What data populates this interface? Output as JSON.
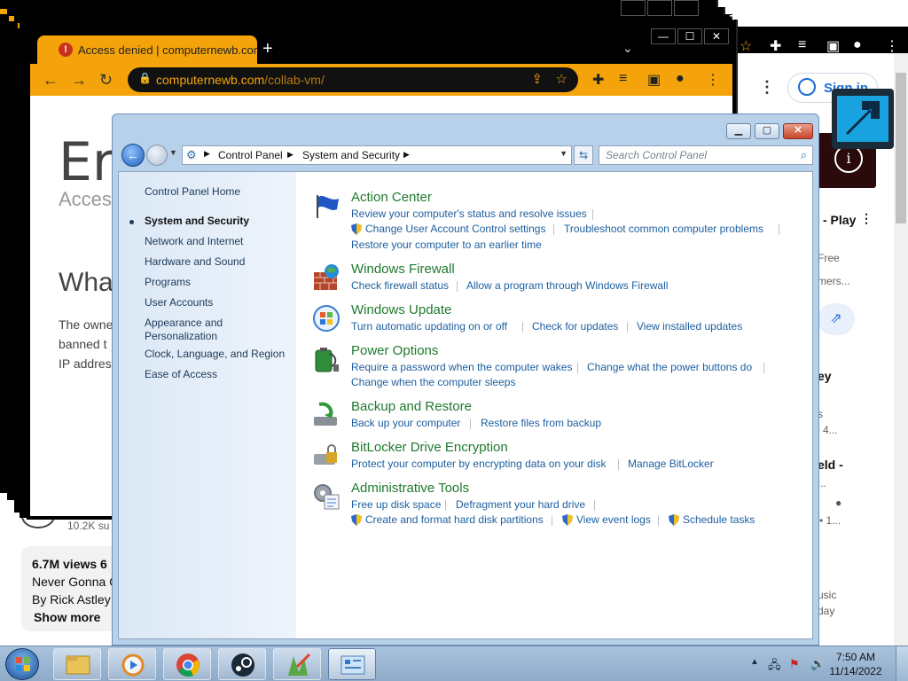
{
  "browser": {
    "tab_title": "Access denied | computernewb.com",
    "tab_close_icon": "close-icon",
    "new_tab_icon": "plus-icon",
    "address": {
      "host": "computernewb.com",
      "path": "/collab-vm/"
    },
    "window_controls": [
      "–",
      "☐",
      "✕"
    ]
  },
  "error_page": {
    "title": "Err",
    "subtitle": "Acces",
    "heading": "Wha",
    "lines": [
      "The owne",
      "banned t",
      "IP addres"
    ]
  },
  "youtube_background": {
    "sign_in": "Sign in",
    "play_text": "- Play",
    "free_text": "Free",
    "mers_text": "mers...",
    "ey_text": "ey",
    "s_text": "s",
    "num4_text": "4...",
    "eld_text": "eld -",
    "dots_text": "...",
    "one_text": "• 1...",
    "usic_text": "usic",
    "day_text": "day",
    "subscribers": "10.2K su",
    "views": "6.7M views  6",
    "desc_line1": "Never Gonna G",
    "desc_line2": "By Rick Astley",
    "show_more": "Show more"
  },
  "control_panel": {
    "window_buttons": [
      "▁",
      "▢",
      "✕"
    ],
    "breadcrumb": [
      "Control Panel",
      "System and Security"
    ],
    "search_placeholder": "Search Control Panel",
    "left_nav": [
      {
        "label": "Control Panel Home"
      },
      {
        "label": "System and Security"
      },
      {
        "label": "Network and Internet"
      },
      {
        "label": "Hardware and Sound"
      },
      {
        "label": "Programs"
      },
      {
        "label": "User Accounts"
      },
      {
        "label": "Appearance and"
      },
      {
        "label": "Personalization"
      },
      {
        "label": "Clock, Language, and Region"
      },
      {
        "label": "Ease of Access"
      }
    ],
    "sections": [
      {
        "title": "Action Center",
        "icon": "flag-icon",
        "links": [
          "Review your computer's status and resolve issues",
          "Change User Account Control settings",
          "Troubleshoot common computer problems",
          "Restore your computer to an earlier time"
        ]
      },
      {
        "title": "Windows Firewall",
        "icon": "firewall-icon",
        "links": [
          "Check firewall status",
          "Allow a program through Windows Firewall"
        ]
      },
      {
        "title": "Windows Update",
        "icon": "update-icon",
        "links": [
          "Turn automatic updating on or off",
          "Check for updates",
          "View installed updates"
        ]
      },
      {
        "title": "Power Options",
        "icon": "battery-icon",
        "links": [
          "Require a password when the computer wakes",
          "Change what the power buttons do",
          "Change when the computer sleeps"
        ]
      },
      {
        "title": "Backup and Restore",
        "icon": "backup-icon",
        "links": [
          "Back up your computer",
          "Restore files from backup"
        ]
      },
      {
        "title": "BitLocker Drive Encryption",
        "icon": "bitlocker-icon",
        "links": [
          "Protect your computer by encrypting data on your disk",
          "Manage BitLocker"
        ]
      },
      {
        "title": "Administrative Tools",
        "icon": "admin-tools-icon",
        "links": [
          "Free up disk space",
          "Defragment your hard drive",
          "Create and format hard disk partitions",
          "View event logs",
          "Schedule tasks"
        ]
      }
    ]
  },
  "taskbar": {
    "apps": [
      "explorer-icon",
      "media-player-icon",
      "chrome-icon",
      "steam-icon",
      "paint-icon",
      "control-panel-icon"
    ],
    "time": "7:50 AM",
    "date": "11/14/2022"
  },
  "colors": {
    "chrome_accent": "#f4a40a",
    "cp_title": "#1f7a2e",
    "cp_link": "#1d5fa0"
  }
}
